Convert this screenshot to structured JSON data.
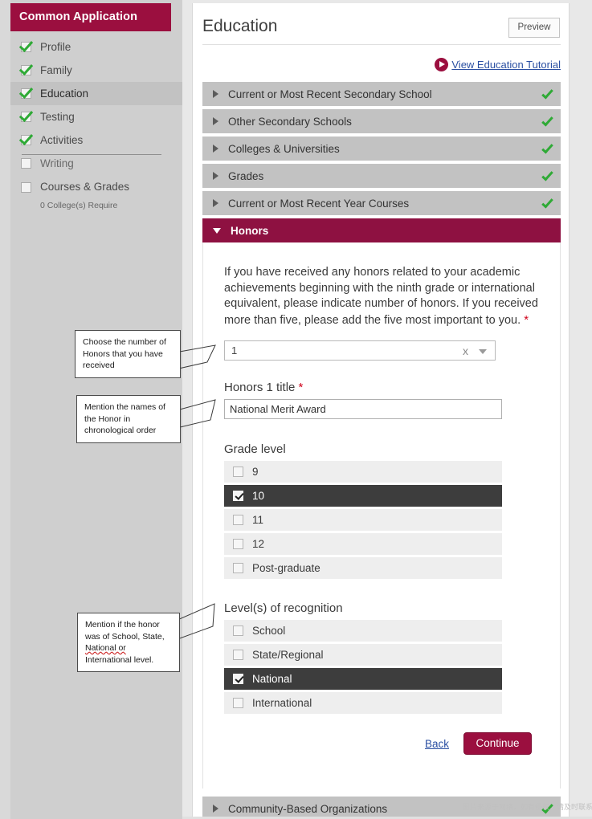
{
  "sidebar": {
    "app_title": "Common Application",
    "items": [
      {
        "label": "Profile",
        "checked": true,
        "active": false
      },
      {
        "label": "Family",
        "checked": true,
        "active": false
      },
      {
        "label": "Education",
        "checked": true,
        "active": true
      },
      {
        "label": "Testing",
        "checked": true,
        "active": false
      },
      {
        "label": "Activities",
        "checked": true,
        "active": false
      },
      {
        "label": "Writing",
        "checked": false,
        "active": false
      }
    ],
    "courses_grades": {
      "label": "Courses & Grades",
      "sub_label": "0 College(s) Require",
      "checked": false
    }
  },
  "header": {
    "page_title": "Education",
    "preview_label": "Preview",
    "tutorial_link": "View Education Tutorial",
    "play_icon": "play-circle-icon"
  },
  "accordion": [
    {
      "label": "Current or Most Recent Secondary School",
      "complete": true,
      "open": false
    },
    {
      "label": "Other Secondary Schools",
      "complete": true,
      "open": false
    },
    {
      "label": "Colleges & Universities",
      "complete": true,
      "open": false
    },
    {
      "label": "Grades",
      "complete": true,
      "open": false
    },
    {
      "label": "Current or Most Recent Year Courses",
      "complete": true,
      "open": false
    },
    {
      "label": "Honors",
      "complete": false,
      "open": true
    },
    {
      "label": "Community-Based Organizations",
      "complete": true,
      "open": false
    }
  ],
  "honors_form": {
    "intro_text": "If you have received any honors related to your academic achievements beginning with the ninth grade or international equivalent, please indicate number of honors. If you received more than five, please add the five most important to you.",
    "required_marker": "*",
    "count_select": {
      "value": "1",
      "clear_icon": "x",
      "caret_icon": "chevron-down-icon"
    },
    "title_field": {
      "label": "Honors 1 title",
      "value": "National Merit Award"
    },
    "grade_level": {
      "label": "Grade level",
      "options": [
        {
          "label": "9",
          "checked": false
        },
        {
          "label": "10",
          "checked": true
        },
        {
          "label": "11",
          "checked": false
        },
        {
          "label": "12",
          "checked": false
        },
        {
          "label": "Post-graduate",
          "checked": false
        }
      ]
    },
    "recognition": {
      "label": "Level(s) of recognition",
      "options": [
        {
          "label": "School",
          "checked": false
        },
        {
          "label": "State/Regional",
          "checked": false
        },
        {
          "label": "National",
          "checked": true
        },
        {
          "label": "International",
          "checked": false
        }
      ]
    },
    "back_label": "Back",
    "continue_label": "Continue"
  },
  "callouts": [
    {
      "line1": "Choose the number of",
      "line2": "Honors that you have",
      "line3": "received"
    },
    {
      "line1": "Mention the names of",
      "line2": "the Honor in",
      "line3": "chronological order"
    },
    {
      "line1": "Mention if the honor",
      "line2": "was of School, State,",
      "line3": "National or",
      "line4": "International level."
    }
  ],
  "watermark": "图片来源于网络，如有侵权，请及时联系删除。",
  "colors": {
    "brand_maroon": "#9b0f3f",
    "accordion_open": "#8e1141",
    "accordion_bar": "#c2c2c2",
    "check_green": "#2faa36",
    "required_red": "#d0021b",
    "link_blue": "#2a4fa2",
    "selected_row": "#3d3d3d",
    "sidebar_bg": "#cfcfcf"
  }
}
